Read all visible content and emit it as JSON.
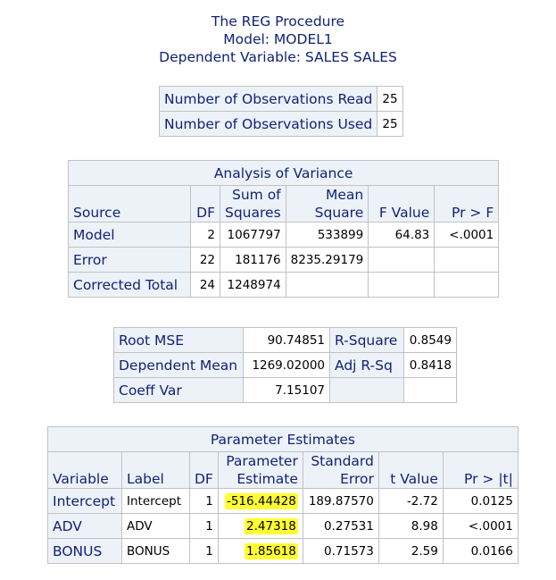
{
  "titles": {
    "line1": "The REG Procedure",
    "line2": "Model: MODEL1",
    "line3": "Dependent Variable: SALES SALES"
  },
  "observations": {
    "rows": [
      {
        "label": "Number of Observations Read",
        "value": "25"
      },
      {
        "label": "Number of Observations Used",
        "value": "25"
      }
    ]
  },
  "anova": {
    "caption": "Analysis of Variance",
    "headers": {
      "source": "Source",
      "df": "DF",
      "ss_line1": "Sum of",
      "ss_line2": "Squares",
      "ms_line1": "Mean",
      "ms_line2": "Square",
      "f": "F Value",
      "p": "Pr > F"
    },
    "rows": [
      {
        "source": "Model",
        "df": "2",
        "ss": "1067797",
        "ms": "533899",
        "f": "64.83",
        "p": "<.0001"
      },
      {
        "source": "Error",
        "df": "22",
        "ss": "181176",
        "ms": "8235.29179",
        "f": "",
        "p": ""
      },
      {
        "source": "Corrected Total",
        "df": "24",
        "ss": "1248974",
        "ms": "",
        "f": "",
        "p": ""
      }
    ]
  },
  "fit": {
    "rows": [
      {
        "label1": "Root MSE",
        "value1": "90.74851",
        "label2": "R-Square",
        "value2": "0.8549"
      },
      {
        "label1": "Dependent Mean",
        "value1": "1269.02000",
        "label2": "Adj R-Sq",
        "value2": "0.8418"
      },
      {
        "label1": "Coeff Var",
        "value1": "7.15107",
        "label2": "",
        "value2": ""
      }
    ]
  },
  "params": {
    "caption": "Parameter Estimates",
    "headers": {
      "variable": "Variable",
      "label": "Label",
      "df": "DF",
      "est_line1": "Parameter",
      "est_line2": "Estimate",
      "se_line1": "Standard",
      "se_line2": "Error",
      "t": "t Value",
      "p": "Pr > |t|"
    },
    "rows": [
      {
        "variable": "Intercept",
        "label": "Intercept",
        "df": "1",
        "estimate": "-516.44428",
        "se": "189.87570",
        "t": "-2.72",
        "p": "0.0125"
      },
      {
        "variable": "ADV",
        "label": "ADV",
        "df": "1",
        "estimate": "2.47318",
        "se": "0.27531",
        "t": "8.98",
        "p": "<.0001"
      },
      {
        "variable": "BONUS",
        "label": "BONUS",
        "df": "1",
        "estimate": "1.85618",
        "se": "0.71573",
        "t": "2.59",
        "p": "0.0166"
      }
    ],
    "highlight_color": "#ffff33"
  }
}
